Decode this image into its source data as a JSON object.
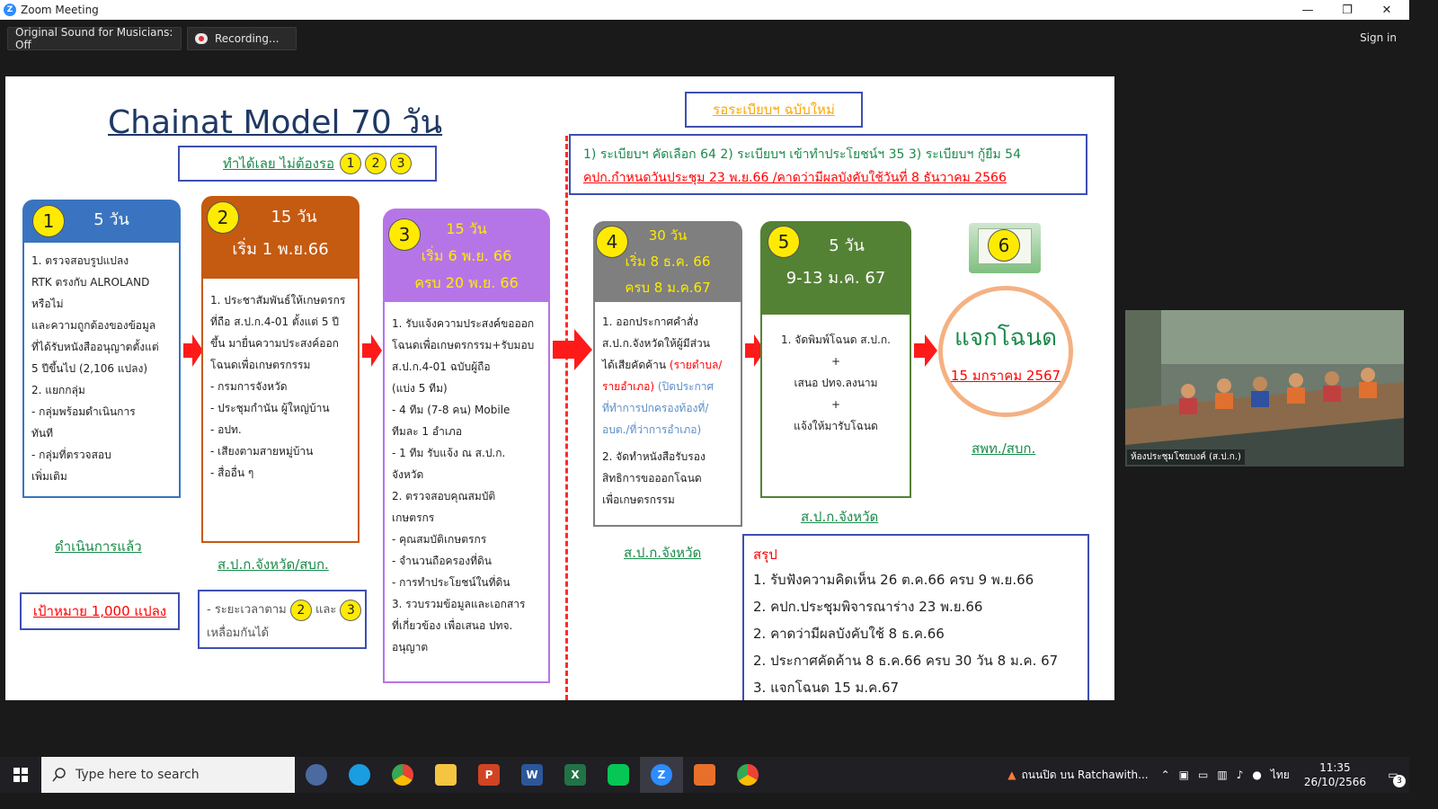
{
  "window": {
    "title": "Zoom Meeting",
    "minimize_glyph": "—",
    "maximize_glyph": "❐",
    "close_glyph": "✕"
  },
  "meeting_bar": {
    "original_sound": "Original Sound for Musicians: Off",
    "recording": "Recording...",
    "sign_in": "Sign in"
  },
  "slide": {
    "title": "Chainat Model 70 วัน",
    "do_now": {
      "label": "ทำได้เลย ไม่ต้องรอ",
      "nums": [
        "1",
        "2",
        "3"
      ]
    },
    "new_regulation": "รอระเบียบฯ ฉบับใหม่",
    "regs": {
      "line1": "1) ระเบียบฯ คัดเลือก 64  2) ระเบียบฯ เข้าทำประโยชน์ฯ 35  3) ระเบียบฯ กู้ยืม 54",
      "line2": "คปก.กำหนดวันประชุม 23 พ.ย.66 /คาดว่ามีผลบังคับใช้วันที่ 8 ธันวาคม 2566"
    },
    "steps": [
      {
        "num": "1",
        "head": [
          "5 วัน"
        ],
        "body": [
          "1. ตรวจสอบรูปแปลง",
          "RTK   ตรงกับ ALROLAND",
          "หรือไม่",
          "และความถูกต้องของข้อมูล",
          "ที่ได้รับหนังสืออนุญาตตั้งแต่",
          "5 ปีขึ้นไป (2,106 แปลง)",
          "   2. แยกกลุ่ม",
          "      - กลุ่มพร้อมดำเนินการ",
          "ทันที",
          "      - กลุ่มที่ตรวจสอบ",
          "เพิ่มเติม"
        ],
        "footer": "ดำเนินการแล้ว"
      },
      {
        "num": "2",
        "head": [
          "15 วัน",
          "เริ่ม 1 พ.ย.66"
        ],
        "body": [
          "1. ประชาสัมพันธ์ให้เกษตรกร",
          "ที่ถือ ส.ป.ก.4-01 ตั้งแต่ 5 ปี",
          "ขึ้น มายื่นความประสงค์ออก",
          "โฉนดเพื่อเกษตรกรรม",
          "   - กรมการจังหวัด",
          "   - ประชุมกำนัน ผู้ใหญ่บ้าน",
          "   - อปท.",
          "   - เสียงตามสายหมู่บ้าน",
          "   - สื่ออื่น ๆ"
        ],
        "footer": "ส.ป.ก.จังหวัด/สบก."
      },
      {
        "num": "3",
        "head": [
          "15 วัน",
          "เริ่ม 6 พ.ย. 66",
          "ครบ 20 พ.ย. 66"
        ],
        "body": [
          "1. รับแจ้งความประสงค์ขอออก",
          "โฉนดเพื่อเกษตรกรรม+รับมอบ",
          "ส.ป.ก.4-01 ฉบับผู้ถือ",
          "(แบ่ง 5 ทีม)",
          "   - 4 ทีม (7-8 คน) Mobile",
          "ทีมละ 1 อำเภอ",
          "   - 1 ทีม รับแจ้ง ณ ส.ป.ก.",
          "จังหวัด",
          "2.  ตรวจสอบคุณสมบัติ",
          "เกษตรกร",
          "   - คุณสมบัติเกษตรกร",
          "   - จำนวนถือครองที่ดิน",
          "   - การทำประโยชน์ในที่ดิน",
          "3. รวบรวมข้อมูลและเอกสาร",
          "ที่เกี่ยวข้อง เพื่อเสนอ ปทจ.",
          "อนุญาต"
        ]
      },
      {
        "num": "4",
        "head": [
          "30 วัน",
          "เริ่ม 8 ธ.ค. 66",
          "ครบ 8  ม.ค.67"
        ],
        "body_a": [
          "1. ออกประกาศคำสั่ง",
          "ส.ป.ก.จังหวัดให้ผู้มีส่วน",
          "ได้เสียคัดค้าน"
        ],
        "body_red": "(รายตำบล/",
        "body_red2": "รายอำเภอ)",
        "body_blue": [
          "(ปิดประกาศ",
          "ที่ทำการปกครองท้องที่/",
          "อบต./ที่ว่าการอำเภอ)"
        ],
        "body_b": [
          "2. จัดทำหนังสือรับรอง",
          "สิทธิการขอออกโฉนด",
          "เพื่อเกษตรกรรม"
        ],
        "footer": "ส.ป.ก.จังหวัด"
      },
      {
        "num": "5",
        "head": [
          "5 วัน",
          "9-13 ม.ค. 67"
        ],
        "body": [
          "1. จัดพิมพ์โฉนด ส.ป.ก.",
          "+",
          "เสนอ ปทจ.ลงนาม",
          "+",
          "แจ้งให้มารับโฉนด"
        ],
        "footer": "ส.ป.ก.จังหวัด"
      },
      {
        "num": "6",
        "circle_title": "แจกโฉนด",
        "circle_date": "15 มกราคม 2567",
        "footer": "สพท./สบก."
      }
    ],
    "target": "เป้าหมาย 1,000 แปลง",
    "overlap": {
      "pre": "- ระยะเวลาตาม",
      "mid": "และ",
      "post": "เหลื่อมกันได้",
      "n1": "2",
      "n2": "3"
    },
    "summary": {
      "title": "สรุป",
      "items": [
        "1. รับฟังความคิดเห็น 26 ต.ค.66 ครบ 9 พ.ย.66",
        "2. คปก.ประชุมพิจารณาร่าง 23 พ.ย.66",
        "2. คาดว่ามีผลบังคับใช้ 8 ธ.ค.66",
        "2. ประกาศคัดค้าน 8 ธ.ค.66 ครบ 30 วัน 8 ม.ค. 67",
        "3. แจกโฉนด 15 ม.ค.67"
      ]
    }
  },
  "video_tile": {
    "caption": "ห้องประชุมโชยบงค์ (ส.ป.ก.)"
  },
  "taskbar": {
    "search_placeholder": "Type here to search",
    "weather": "ถนนปิด บน Ratchawith...",
    "lang": "ไทย",
    "time": "11:35",
    "date": "26/10/2566",
    "notif_count": "3"
  },
  "colors": {
    "step1": "#3a74c0",
    "step2": "#c55a11",
    "step3": "#b675e6",
    "step4": "#7f7f7f",
    "step5": "#548235",
    "red": "#ff0000",
    "green": "#1a8a4a",
    "orange": "#ffa500"
  }
}
